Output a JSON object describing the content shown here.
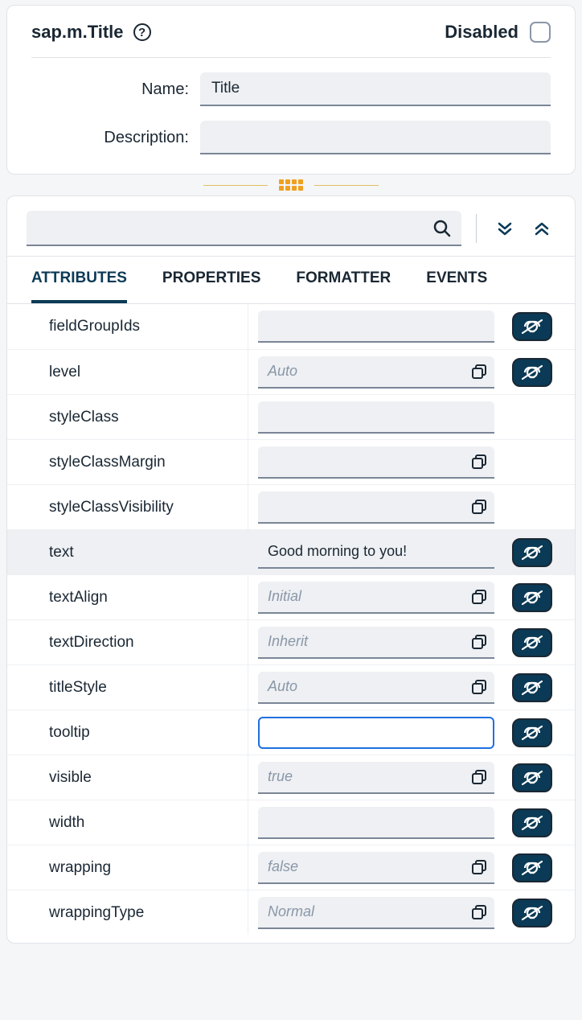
{
  "header": {
    "title": "sap.m.Title",
    "disabled_label": "Disabled",
    "name_label": "Name:",
    "description_label": "Description:",
    "name_value": "Title",
    "description_value": ""
  },
  "search": {
    "value": ""
  },
  "tabs": {
    "attributes": "ATTRIBUTES",
    "properties": "PROPERTIES",
    "formatter": "FORMATTER",
    "events": "EVENTS",
    "active": "attributes"
  },
  "attributes": [
    {
      "name": "fieldGroupIds",
      "value": "",
      "placeholder": "",
      "hasDialog": false,
      "hasBind": true,
      "focused": false,
      "highlight": false
    },
    {
      "name": "level",
      "value": "",
      "placeholder": "Auto",
      "hasDialog": true,
      "hasBind": true,
      "focused": false,
      "highlight": false
    },
    {
      "name": "styleClass",
      "value": "",
      "placeholder": "",
      "hasDialog": false,
      "hasBind": false,
      "focused": false,
      "highlight": false
    },
    {
      "name": "styleClassMargin",
      "value": "",
      "placeholder": "",
      "hasDialog": true,
      "hasBind": false,
      "focused": false,
      "highlight": false
    },
    {
      "name": "styleClassVisibility",
      "value": "",
      "placeholder": "",
      "hasDialog": true,
      "hasBind": false,
      "focused": false,
      "highlight": false
    },
    {
      "name": "text",
      "value": "Good morning to you!",
      "placeholder": "",
      "hasDialog": false,
      "hasBind": true,
      "focused": false,
      "highlight": true
    },
    {
      "name": "textAlign",
      "value": "",
      "placeholder": "Initial",
      "hasDialog": true,
      "hasBind": true,
      "focused": false,
      "highlight": false
    },
    {
      "name": "textDirection",
      "value": "",
      "placeholder": "Inherit",
      "hasDialog": true,
      "hasBind": true,
      "focused": false,
      "highlight": false
    },
    {
      "name": "titleStyle",
      "value": "",
      "placeholder": "Auto",
      "hasDialog": true,
      "hasBind": true,
      "focused": false,
      "highlight": false
    },
    {
      "name": "tooltip",
      "value": "",
      "placeholder": "",
      "hasDialog": false,
      "hasBind": true,
      "focused": true,
      "highlight": false
    },
    {
      "name": "visible",
      "value": "",
      "placeholder": "true",
      "hasDialog": true,
      "hasBind": true,
      "focused": false,
      "highlight": false
    },
    {
      "name": "width",
      "value": "",
      "placeholder": "",
      "hasDialog": false,
      "hasBind": true,
      "focused": false,
      "highlight": false
    },
    {
      "name": "wrapping",
      "value": "",
      "placeholder": "false",
      "hasDialog": true,
      "hasBind": true,
      "focused": false,
      "highlight": false
    },
    {
      "name": "wrappingType",
      "value": "",
      "placeholder": "Normal",
      "hasDialog": true,
      "hasBind": true,
      "focused": false,
      "highlight": false
    }
  ]
}
